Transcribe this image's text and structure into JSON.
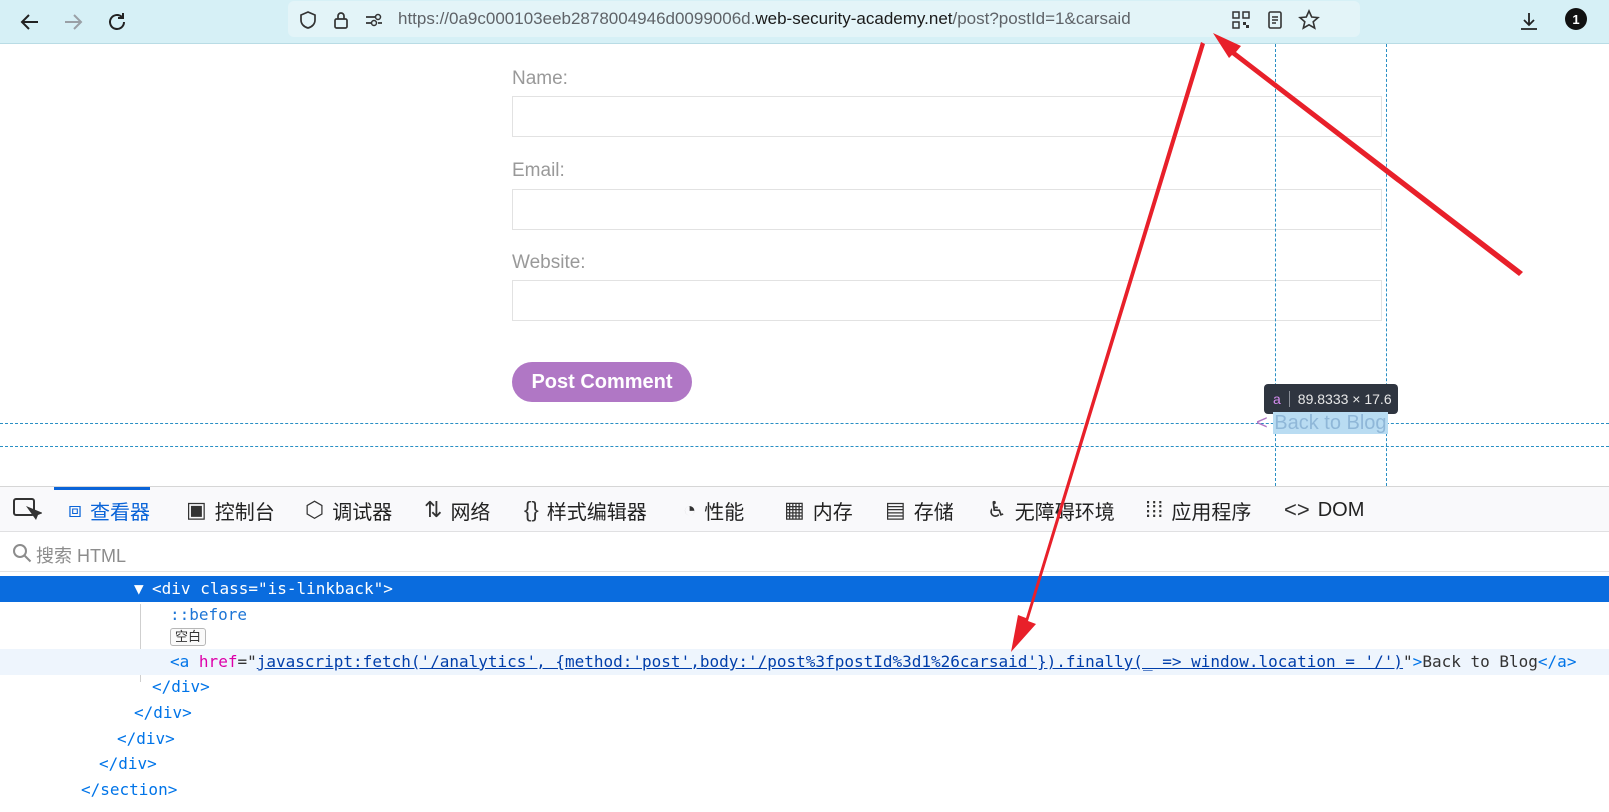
{
  "browser": {
    "url_prefix": "https://0a9c000103eeb2878004946d0099006d.",
    "url_domain": "web-security-academy.net",
    "url_path": "/post?postId=1&carsaid",
    "notification_count": "1"
  },
  "form": {
    "name_label": "Name:",
    "email_label": "Email:",
    "website_label": "Website:",
    "submit_label": "Post Comment"
  },
  "inspector_tooltip": {
    "tag": "a",
    "size": "89.8333 × 17.6"
  },
  "page": {
    "back_prefix": "< ",
    "back_text": "Back to Blog"
  },
  "devtools": {
    "tabs": [
      {
        "label": "查看器",
        "icon": "inspector-icon"
      },
      {
        "label": "控制台",
        "icon": "console-icon"
      },
      {
        "label": "调试器",
        "icon": "debugger-icon"
      },
      {
        "label": "网络",
        "icon": "network-icon"
      },
      {
        "label": "样式编辑器",
        "icon": "style-editor-icon"
      },
      {
        "label": "性能",
        "icon": "performance-icon"
      },
      {
        "label": "内存",
        "icon": "memory-icon"
      },
      {
        "label": "存储",
        "icon": "storage-icon"
      },
      {
        "label": "无障碍环境",
        "icon": "accessibility-icon"
      },
      {
        "label": "应用程序",
        "icon": "application-icon"
      },
      {
        "label": "DOM",
        "icon": "dom-icon"
      }
    ],
    "search_placeholder": "搜索 HTML",
    "tree": {
      "div_open_tag": "div",
      "div_class_attr": "class",
      "div_class_value": "is-linkback",
      "before": "::before",
      "whitespace": "空白",
      "a_tag": "a",
      "a_attr": "href",
      "a_href": "javascript:fetch('/analytics', {method:'post',body:'/post%3fpostId%3d1%26carsaid'}).finally(_ => window.location = '/')",
      "a_text": "Back to Blog",
      "close_div": "div",
      "close_section": "section"
    }
  },
  "colors": {
    "accent": "#b077c5",
    "devtools_selection": "#0a6cde",
    "annotation_arrow": "#e8202a"
  }
}
